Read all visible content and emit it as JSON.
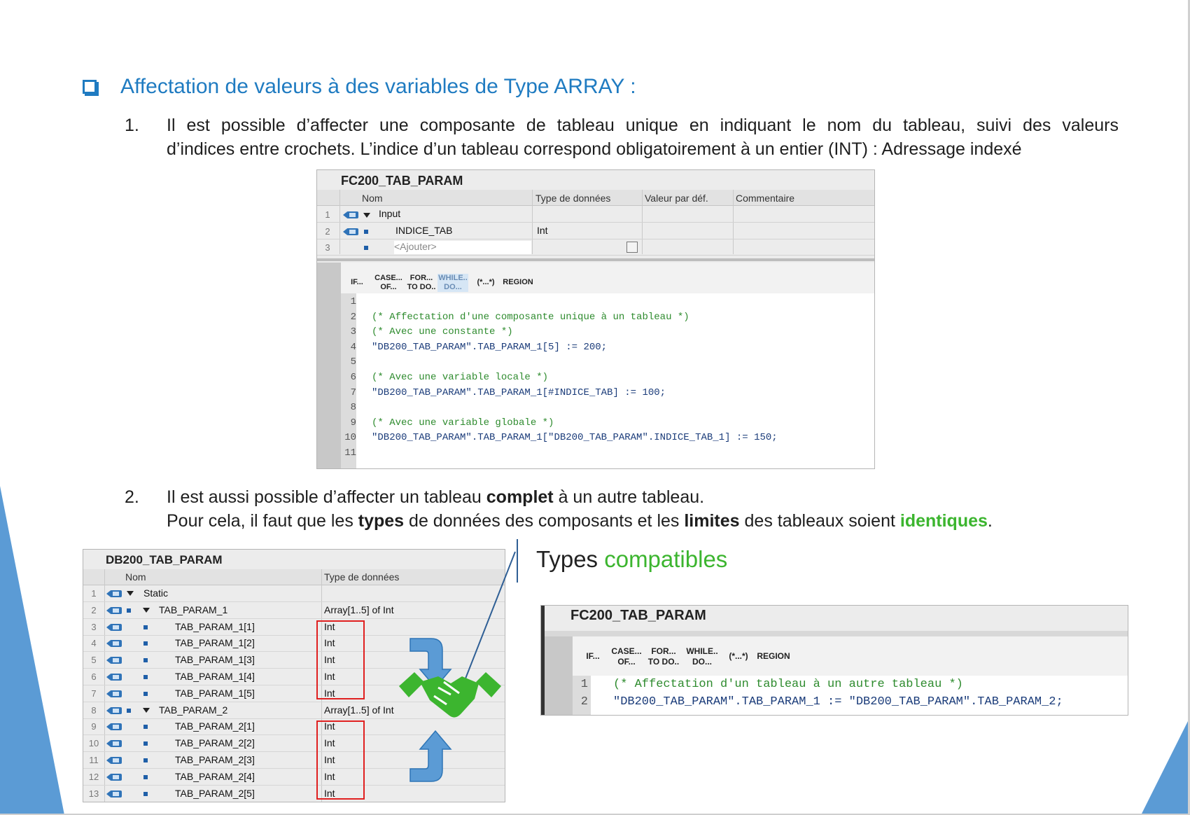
{
  "heading": "Affectation de valeurs à des variables de Type ARRAY :",
  "item1": {
    "number": "1.",
    "line1": "Il est possible d’affecter une composante de tableau unique en indiquant le nom du tableau, suivi des valeurs",
    "line2": "d’indices entre crochets. L’indice d’un tableau correspond obligatoirement à un entier (INT) : Adressage indexé"
  },
  "fc_top": {
    "title": "FC200_TAB_PARAM",
    "headers": [
      "Nom",
      "Type de données",
      "Valeur par déf.",
      "Commentaire"
    ],
    "rows": [
      {
        "num": "1",
        "name": "Input",
        "type": ""
      },
      {
        "num": "2",
        "name": "INDICE_TAB",
        "type": "Int"
      },
      {
        "num": "3",
        "name": "<Ajouter>",
        "type": ""
      }
    ],
    "toolbar": [
      "IF...",
      "CASE...\nOF...",
      "FOR...\nTO DO..",
      "WHILE..\nDO...",
      "(*...*)",
      "REGION"
    ],
    "code": [
      {
        "n": "1",
        "text": "",
        "kind": "code"
      },
      {
        "n": "2",
        "text": "(* Affectation d'une composante unique à un tableau *)",
        "kind": "comment"
      },
      {
        "n": "3",
        "text": "(* Avec une constante *)",
        "kind": "comment"
      },
      {
        "n": "4",
        "text": "\"DB200_TAB_PARAM\".TAB_PARAM_1[5] := 200;",
        "kind": "code"
      },
      {
        "n": "5",
        "text": "",
        "kind": "code"
      },
      {
        "n": "6",
        "text": "(* Avec une variable locale *)",
        "kind": "comment"
      },
      {
        "n": "7",
        "text": "\"DB200_TAB_PARAM\".TAB_PARAM_1[#INDICE_TAB] := 100;",
        "kind": "code"
      },
      {
        "n": "8",
        "text": "",
        "kind": "code"
      },
      {
        "n": "9",
        "text": "(* Avec une variable globale *)",
        "kind": "comment"
      },
      {
        "n": "10",
        "text": "\"DB200_TAB_PARAM\".TAB_PARAM_1[\"DB200_TAB_PARAM\".INDICE_TAB_1] := 150;",
        "kind": "code"
      },
      {
        "n": "11",
        "text": "",
        "kind": "code"
      }
    ]
  },
  "item2": {
    "number": "2.",
    "line1_a": "Il est aussi possible d’affecter un tableau ",
    "line1_b": "complet",
    "line1_c": " à un autre tableau.",
    "line2_a": "Pour cela, il faut que les ",
    "line2_b": "types",
    "line2_c": " de données des composants et les ",
    "line2_d": "limites",
    "line2_e": " des tableaux soient ",
    "line2_f": "identiques",
    "line2_g": "."
  },
  "db": {
    "title": "DB200_TAB_PARAM",
    "headers": [
      "Nom",
      "Type de données"
    ],
    "rows": [
      {
        "num": "1",
        "name": "Static",
        "type": "",
        "level": 0
      },
      {
        "num": "2",
        "name": "TAB_PARAM_1",
        "type": "Array[1..5] of Int",
        "level": 1
      },
      {
        "num": "3",
        "name": "TAB_PARAM_1[1]",
        "type": "Int",
        "level": 2
      },
      {
        "num": "4",
        "name": "TAB_PARAM_1[2]",
        "type": "Int",
        "level": 2
      },
      {
        "num": "5",
        "name": "TAB_PARAM_1[3]",
        "type": "Int",
        "level": 2
      },
      {
        "num": "6",
        "name": "TAB_PARAM_1[4]",
        "type": "Int",
        "level": 2
      },
      {
        "num": "7",
        "name": "TAB_PARAM_1[5]",
        "type": "Int",
        "level": 2
      },
      {
        "num": "8",
        "name": "TAB_PARAM_2",
        "type": "Array[1..5] of Int",
        "level": 1
      },
      {
        "num": "9",
        "name": "TAB_PARAM_2[1]",
        "type": "Int",
        "level": 2
      },
      {
        "num": "10",
        "name": "TAB_PARAM_2[2]",
        "type": "Int",
        "level": 2
      },
      {
        "num": "11",
        "name": "TAB_PARAM_2[3]",
        "type": "Int",
        "level": 2
      },
      {
        "num": "12",
        "name": "TAB_PARAM_2[4]",
        "type": "Int",
        "level": 2
      },
      {
        "num": "13",
        "name": "TAB_PARAM_2[5]",
        "type": "Int",
        "level": 2
      }
    ]
  },
  "types_label": {
    "a": "Types ",
    "b": "compatibles"
  },
  "fc_bottom": {
    "title": "FC200_TAB_PARAM",
    "toolbar": [
      "IF...",
      "CASE...\nOF...",
      "FOR...\nTO DO..",
      "WHILE..\nDO...",
      "(*...*)",
      "REGION"
    ],
    "code": [
      {
        "n": "1",
        "text": "(* Affectation d'un tableau à un autre tableau *)",
        "kind": "comment"
      },
      {
        "n": "2",
        "text": "\"DB200_TAB_PARAM\".TAB_PARAM_1 := \"DB200_TAB_PARAM\".TAB_PARAM_2;",
        "kind": "code"
      }
    ]
  },
  "colors": {
    "accent": "#1f7bc1",
    "green": "#3cb52f",
    "red": "#e02020"
  }
}
